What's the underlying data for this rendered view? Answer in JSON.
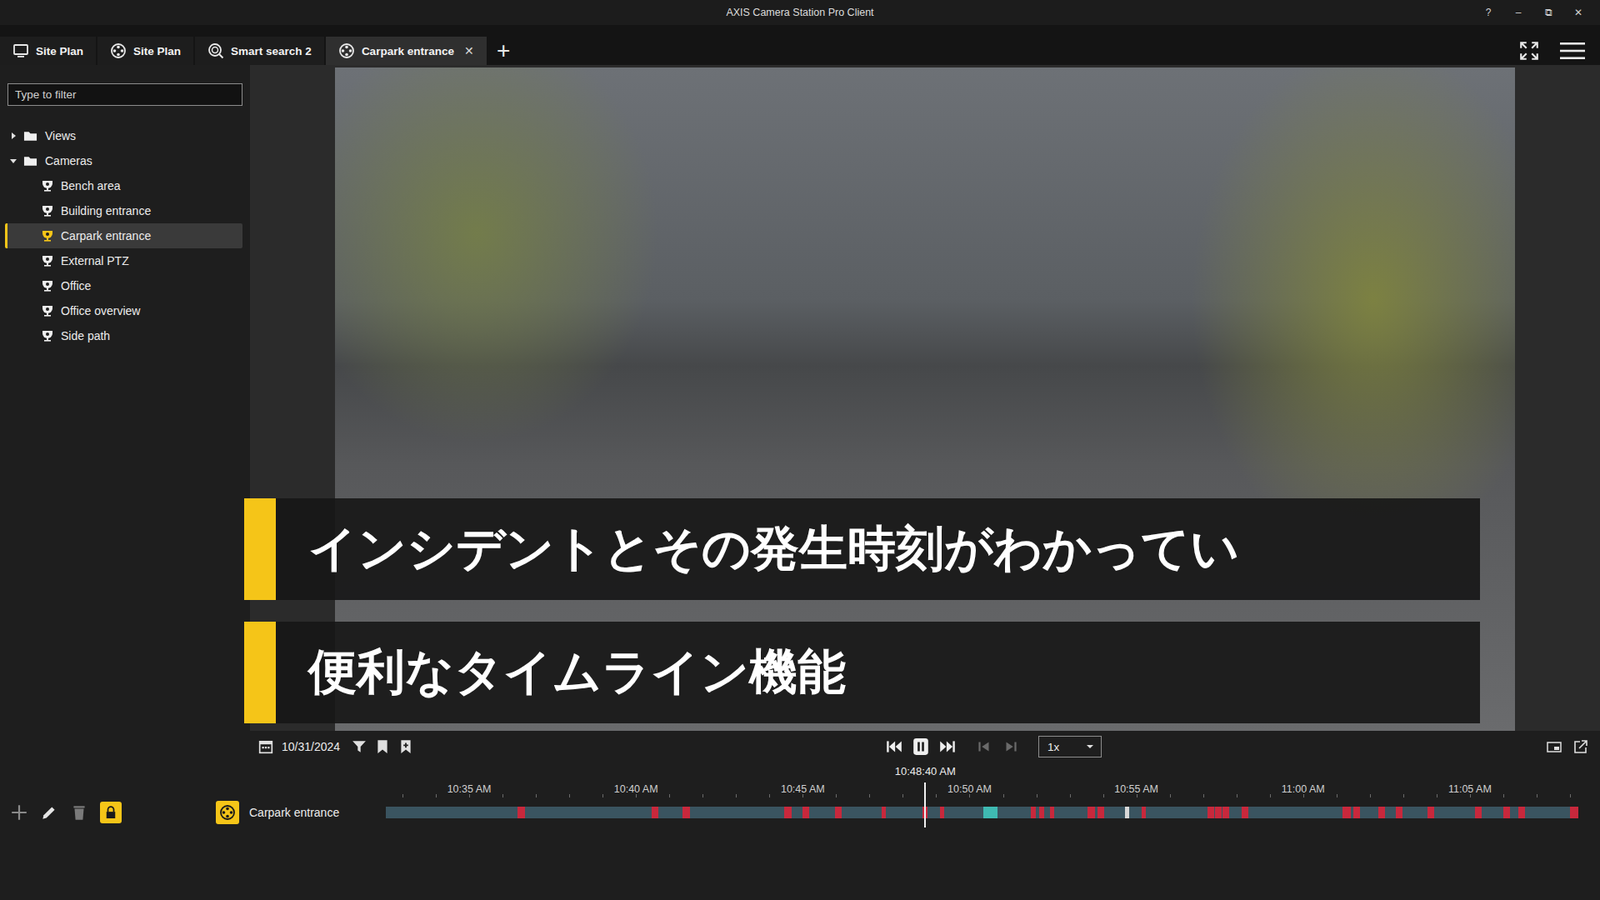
{
  "window": {
    "title": "AXIS Camera Station Pro Client",
    "controls": [
      "?",
      "–",
      "⧉",
      "✕"
    ]
  },
  "tabs": [
    {
      "label": "Site Plan",
      "kind": "screen",
      "selected": false,
      "closable": false
    },
    {
      "label": "Site Plan",
      "kind": "reel",
      "selected": false,
      "closable": false
    },
    {
      "label": "Smart search 2",
      "kind": "search",
      "selected": false,
      "closable": false
    },
    {
      "label": "Carpark entrance",
      "kind": "reel",
      "selected": true,
      "closable": true
    }
  ],
  "tab_close": "✕",
  "tab_add": "+",
  "sidebar": {
    "filter_placeholder": "Type to filter",
    "tree": [
      {
        "label": "Views",
        "expanded": false,
        "children": []
      },
      {
        "label": "Cameras",
        "expanded": true,
        "children": [
          {
            "label": "Bench area",
            "selected": false
          },
          {
            "label": "Building entrance",
            "selected": false
          },
          {
            "label": "Carpark entrance",
            "selected": true
          },
          {
            "label": "External PTZ",
            "selected": false
          },
          {
            "label": "Office",
            "selected": false
          },
          {
            "label": "Office overview",
            "selected": false
          },
          {
            "label": "Side path",
            "selected": false
          }
        ]
      }
    ]
  },
  "captions": [
    "インシデントとその発生時刻がわかってい",
    "便利なタイムライン機能"
  ],
  "playback": {
    "date": "10/31/2024",
    "speed": "1x",
    "playing": true,
    "frame_step_disabled": true
  },
  "timeline": {
    "cursor_label": "10:48:40 AM",
    "cursor_minute": 16.17,
    "span_minutes": 35.7,
    "ticks": [
      {
        "label": "10:35 AM",
        "minute": 2.5
      },
      {
        "label": "10:40 AM",
        "minute": 7.5
      },
      {
        "label": "10:45 AM",
        "minute": 12.5
      },
      {
        "label": "10:50 AM",
        "minute": 17.5
      },
      {
        "label": "10:55 AM",
        "minute": 22.5
      },
      {
        "label": "11:00 AM",
        "minute": 27.5
      },
      {
        "label": "11:05 AM",
        "minute": 32.5
      }
    ],
    "track": {
      "label": "Carpark entrance",
      "locked": true,
      "events": [
        {
          "minute": 3.95,
          "duration": 0.22,
          "color": "#c8283c"
        },
        {
          "minute": 7.96,
          "duration": 0.2,
          "color": "#c8283c"
        },
        {
          "minute": 8.9,
          "duration": 0.22,
          "color": "#c8283c"
        },
        {
          "minute": 11.94,
          "duration": 0.22,
          "color": "#c8283c"
        },
        {
          "minute": 12.49,
          "duration": 0.2,
          "color": "#c8283c"
        },
        {
          "minute": 13.47,
          "duration": 0.2,
          "color": "#c8283c"
        },
        {
          "minute": 14.87,
          "duration": 0.12,
          "color": "#c8283c"
        },
        {
          "minute": 16.1,
          "duration": 0.15,
          "color": "#c8283c"
        },
        {
          "minute": 16.62,
          "duration": 0.12,
          "color": "#c8283c"
        },
        {
          "minute": 17.9,
          "duration": 0.43,
          "color": "#3fbab2"
        },
        {
          "minute": 19.34,
          "duration": 0.15,
          "color": "#c8283c"
        },
        {
          "minute": 19.59,
          "duration": 0.15,
          "color": "#c8283c"
        },
        {
          "minute": 19.9,
          "duration": 0.12,
          "color": "#c8283c"
        },
        {
          "minute": 21.03,
          "duration": 0.22,
          "color": "#c8283c"
        },
        {
          "minute": 21.33,
          "duration": 0.2,
          "color": "#c8283c"
        },
        {
          "minute": 22.16,
          "duration": 0.12,
          "color": "#d8d8d8"
        },
        {
          "minute": 22.65,
          "duration": 0.12,
          "color": "#c8283c"
        },
        {
          "minute": 24.64,
          "duration": 0.2,
          "color": "#c8283c"
        },
        {
          "minute": 24.85,
          "duration": 0.2,
          "color": "#c8283c"
        },
        {
          "minute": 25.07,
          "duration": 0.2,
          "color": "#c8283c"
        },
        {
          "minute": 25.65,
          "duration": 0.2,
          "color": "#c8283c"
        },
        {
          "minute": 28.69,
          "duration": 0.25,
          "color": "#c8283c"
        },
        {
          "minute": 29.0,
          "duration": 0.2,
          "color": "#c8283c"
        },
        {
          "minute": 29.75,
          "duration": 0.2,
          "color": "#c8283c"
        },
        {
          "minute": 30.28,
          "duration": 0.2,
          "color": "#c8283c"
        },
        {
          "minute": 31.22,
          "duration": 0.2,
          "color": "#c8283c"
        },
        {
          "minute": 32.66,
          "duration": 0.2,
          "color": "#c8283c"
        },
        {
          "minute": 33.49,
          "duration": 0.2,
          "color": "#c8283c"
        },
        {
          "minute": 33.95,
          "duration": 0.2,
          "color": "#c8283c"
        },
        {
          "minute": 35.51,
          "duration": 0.25,
          "color": "#c8283c"
        }
      ]
    }
  }
}
